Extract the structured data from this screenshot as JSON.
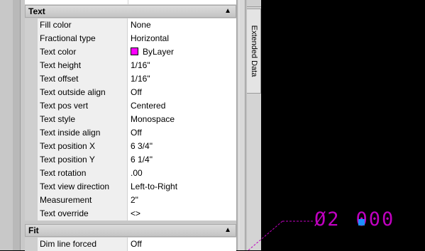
{
  "properties": {
    "sections": [
      {
        "title": "Text",
        "collapse_glyph": "▲",
        "rows": [
          {
            "label": "Fill color",
            "value": "None"
          },
          {
            "label": "Fractional type",
            "value": "Horizontal"
          },
          {
            "label": "Text color",
            "value": "ByLayer",
            "swatch": "#ff00ff"
          },
          {
            "label": "Text height",
            "value": "1/16\""
          },
          {
            "label": "Text offset",
            "value": "1/16\""
          },
          {
            "label": "Text outside align",
            "value": "Off"
          },
          {
            "label": "Text pos vert",
            "value": "Centered"
          },
          {
            "label": "Text style",
            "value": "Monospace"
          },
          {
            "label": "Text inside align",
            "value": "Off"
          },
          {
            "label": "Text position X",
            "value": "6 3/4\""
          },
          {
            "label": "Text position Y",
            "value": "6 1/4\""
          },
          {
            "label": "Text rotation",
            "value": ".00"
          },
          {
            "label": "Text view direction",
            "value": "Left-to-Right"
          },
          {
            "label": "Measurement",
            "value": "2\""
          },
          {
            "label": "Text override",
            "value": "<>"
          }
        ]
      },
      {
        "title": "Fit",
        "collapse_glyph": "▲",
        "rows": [
          {
            "label": "Dim line forced",
            "value": "Off"
          }
        ]
      }
    ]
  },
  "side_tab": {
    "label": "Extended Data"
  },
  "canvas": {
    "dimension_text_left": "Ø2",
    "dimension_text_right": "000",
    "dimension_color": "#c000c0",
    "grip_color": "#1e90ff"
  }
}
